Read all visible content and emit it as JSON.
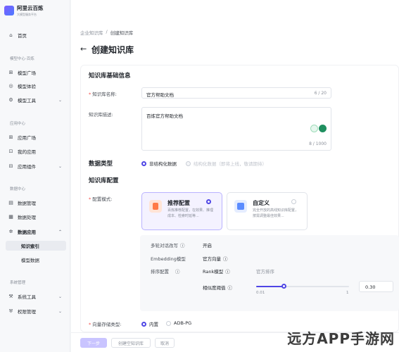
{
  "brand": {
    "name": "阿里云百炼",
    "tagline": "大模型服务平台"
  },
  "sidebar": {
    "home": "首页",
    "groups": [
      {
        "label": "模型中心·百炼",
        "items": [
          {
            "label": "模型广场",
            "icon": "grid-icon"
          },
          {
            "label": "模型体验",
            "icon": "flask-icon"
          },
          {
            "label": "模型工具",
            "icon": "tool-icon",
            "expand": "⌄"
          }
        ]
      },
      {
        "label": "应用中心",
        "items": [
          {
            "label": "应用广场",
            "icon": "apps-icon"
          },
          {
            "label": "我的应用",
            "icon": "app-icon"
          },
          {
            "label": "应用组件",
            "icon": "component-icon",
            "expand": "⌄"
          }
        ]
      },
      {
        "label": "数据中心",
        "items": [
          {
            "label": "数据管理",
            "icon": "database-icon"
          },
          {
            "label": "数据处理",
            "icon": "process-icon"
          },
          {
            "label": "数据应用",
            "icon": "gear-icon",
            "expand": "⌃"
          }
        ]
      },
      {
        "label": "系统管理",
        "items": [
          {
            "label": "系统工具",
            "icon": "wrench-icon",
            "expand": "⌄"
          },
          {
            "label": "权限管理",
            "icon": "shield-icon",
            "expand": "⌄"
          }
        ]
      }
    ],
    "data_app_subitems": [
      "知识索引",
      "模型数据"
    ]
  },
  "breadcrumb": {
    "parent": "企业知识库",
    "sep": "/",
    "current": "创建知识库"
  },
  "page": {
    "back_icon": "←",
    "title": "创建知识库"
  },
  "basic": {
    "section_title": "知识库基础信息",
    "name_label": "知识库名称:",
    "name_value": "官方帮助文档",
    "name_count": "6 / 20",
    "desc_label": "知识库描述:",
    "desc_value": "百炼官方帮助文档",
    "desc_count": "8 / 1000"
  },
  "data_type": {
    "label": "数据类型",
    "opt1": "非结构化数据",
    "opt2": "结构化数据（即将上线，敬请期待）"
  },
  "kb_config": {
    "section_title": "知识库配置",
    "mode_label": "配置模式:",
    "recommended": {
      "title": "推荐配置",
      "desc": "百炼推荐配置，在效果、推理成本、检索时延等..."
    },
    "custom": {
      "title": "自定义",
      "desc": "完全开放的高线知识库配置，按需调整最佳效果..."
    }
  },
  "advanced": {
    "rewrite_label": "多轮对话改写",
    "rewrite_value": "开启",
    "embedding_label": "Embedding模型",
    "embedding_value": "官方向量",
    "rank_label": "排序配置",
    "rank_model_label": "Rank模型",
    "rank_model_value": "官方排序",
    "threshold_label": "相似度阈值",
    "threshold_value": "0.30",
    "threshold_fraction": 0.3,
    "slider_min": "0.01",
    "slider_max": "1"
  },
  "storage": {
    "label": "向量存储类型:",
    "opt1": "内置",
    "opt2": "ADB-PG"
  },
  "footer": {
    "prev": "下一步",
    "create_empty": "创建空知识库",
    "cancel": "取消"
  },
  "watermark": "远方APP手游网",
  "colors": {
    "accent": "#4f46e5",
    "accent_light": "#f4f2ff"
  }
}
